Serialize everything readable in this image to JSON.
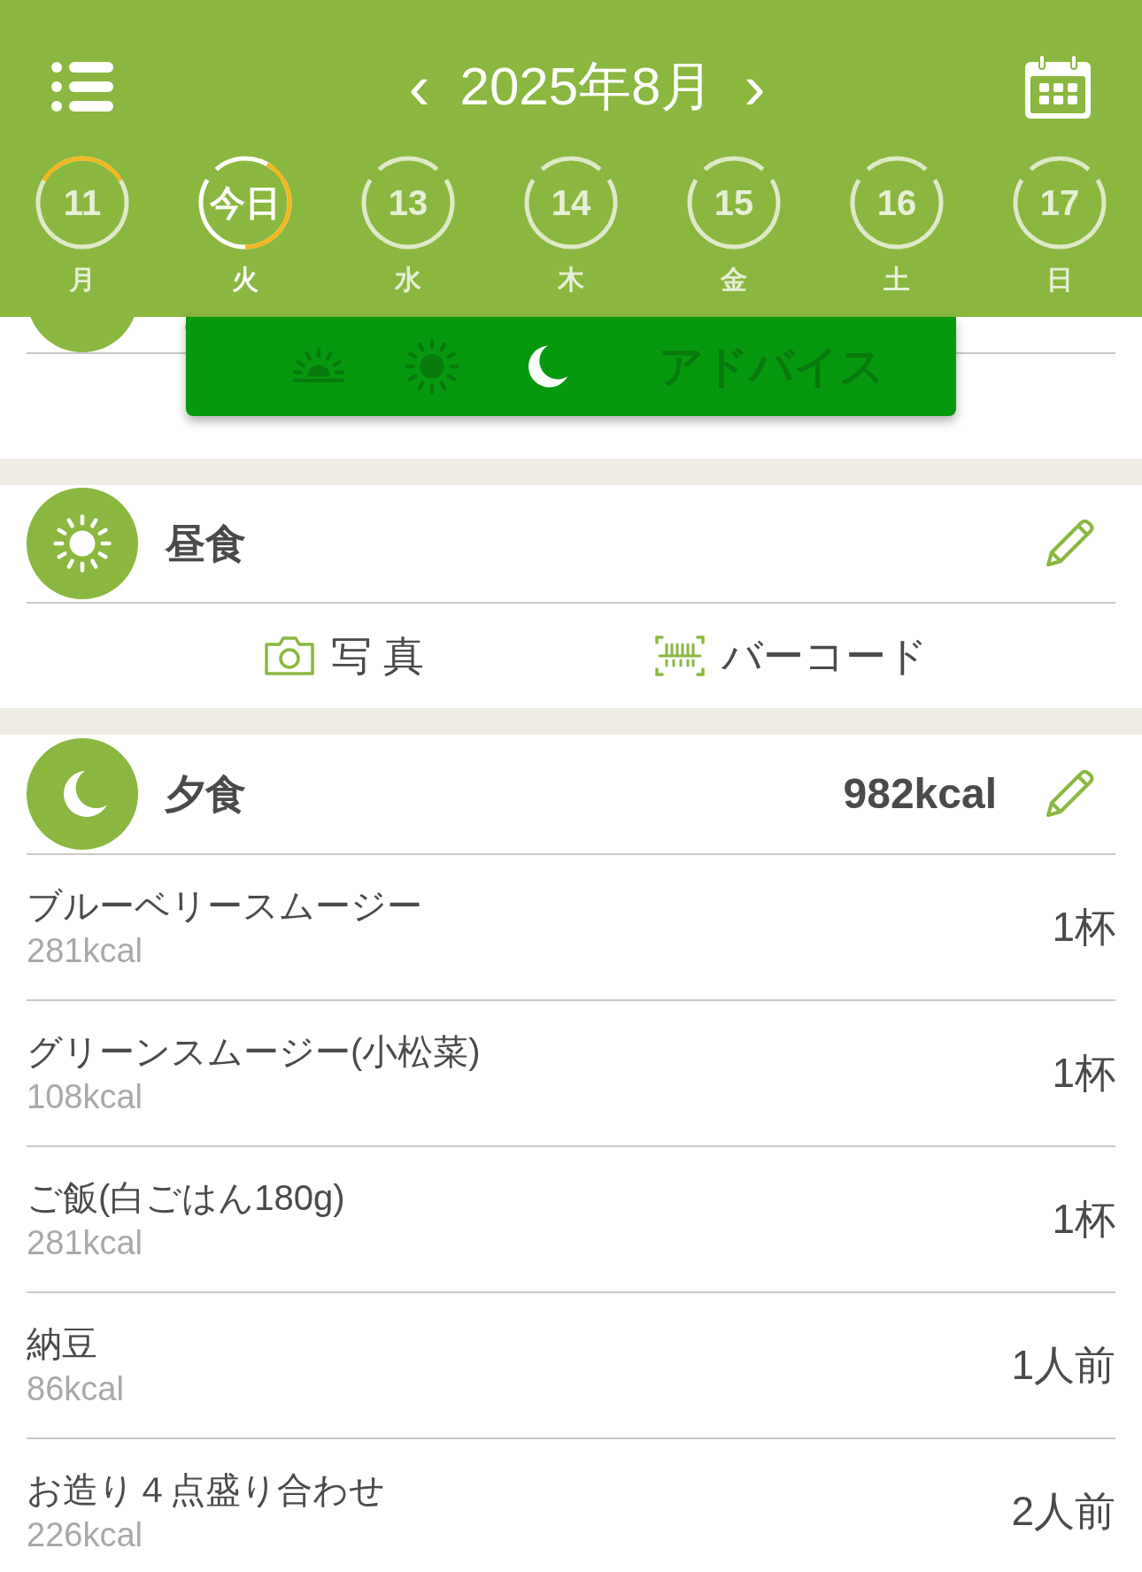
{
  "header": {
    "title": "2025年8月",
    "prev": "‹",
    "next": "›"
  },
  "days": [
    {
      "kind": "top_arc",
      "label": "11",
      "weekday": "月",
      "selected": false
    },
    {
      "kind": "side_arc",
      "label": "今日",
      "weekday": "火",
      "selected": true
    },
    {
      "kind": "plain",
      "label": "13",
      "weekday": "水",
      "selected": false
    },
    {
      "kind": "plain",
      "label": "14",
      "weekday": "木",
      "selected": false
    },
    {
      "kind": "plain",
      "label": "15",
      "weekday": "金",
      "selected": false
    },
    {
      "kind": "plain",
      "label": "16",
      "weekday": "土",
      "selected": false
    },
    {
      "kind": "plain",
      "label": "17",
      "weekday": "日",
      "selected": false
    }
  ],
  "meal_tabs": [
    {
      "kind": "sunrise",
      "selected": false
    },
    {
      "kind": "sun",
      "selected": false
    },
    {
      "kind": "moon",
      "selected": true
    },
    {
      "kind": "text",
      "label": "アドバイス",
      "selected": false
    }
  ],
  "lunch": {
    "title": "昼食",
    "photo": "写 真",
    "barcode": "バーコード"
  },
  "dinner": {
    "title": "夕食",
    "total": "982kcal",
    "items": [
      {
        "name": "ブルーベリースムージー",
        "kcal": "281kcal",
        "amount": "1杯"
      },
      {
        "name": "グリーンスムージー(小松菜)",
        "kcal": "108kcal",
        "amount": "1杯"
      },
      {
        "name": "ご飯(白ごはん180g)",
        "kcal": "281kcal",
        "amount": "1杯"
      },
      {
        "name": "納豆",
        "kcal": "86kcal",
        "amount": "1人前"
      },
      {
        "name": "お造り４点盛り合わせ",
        "kcal": "226kcal",
        "amount": "2人前"
      }
    ]
  }
}
